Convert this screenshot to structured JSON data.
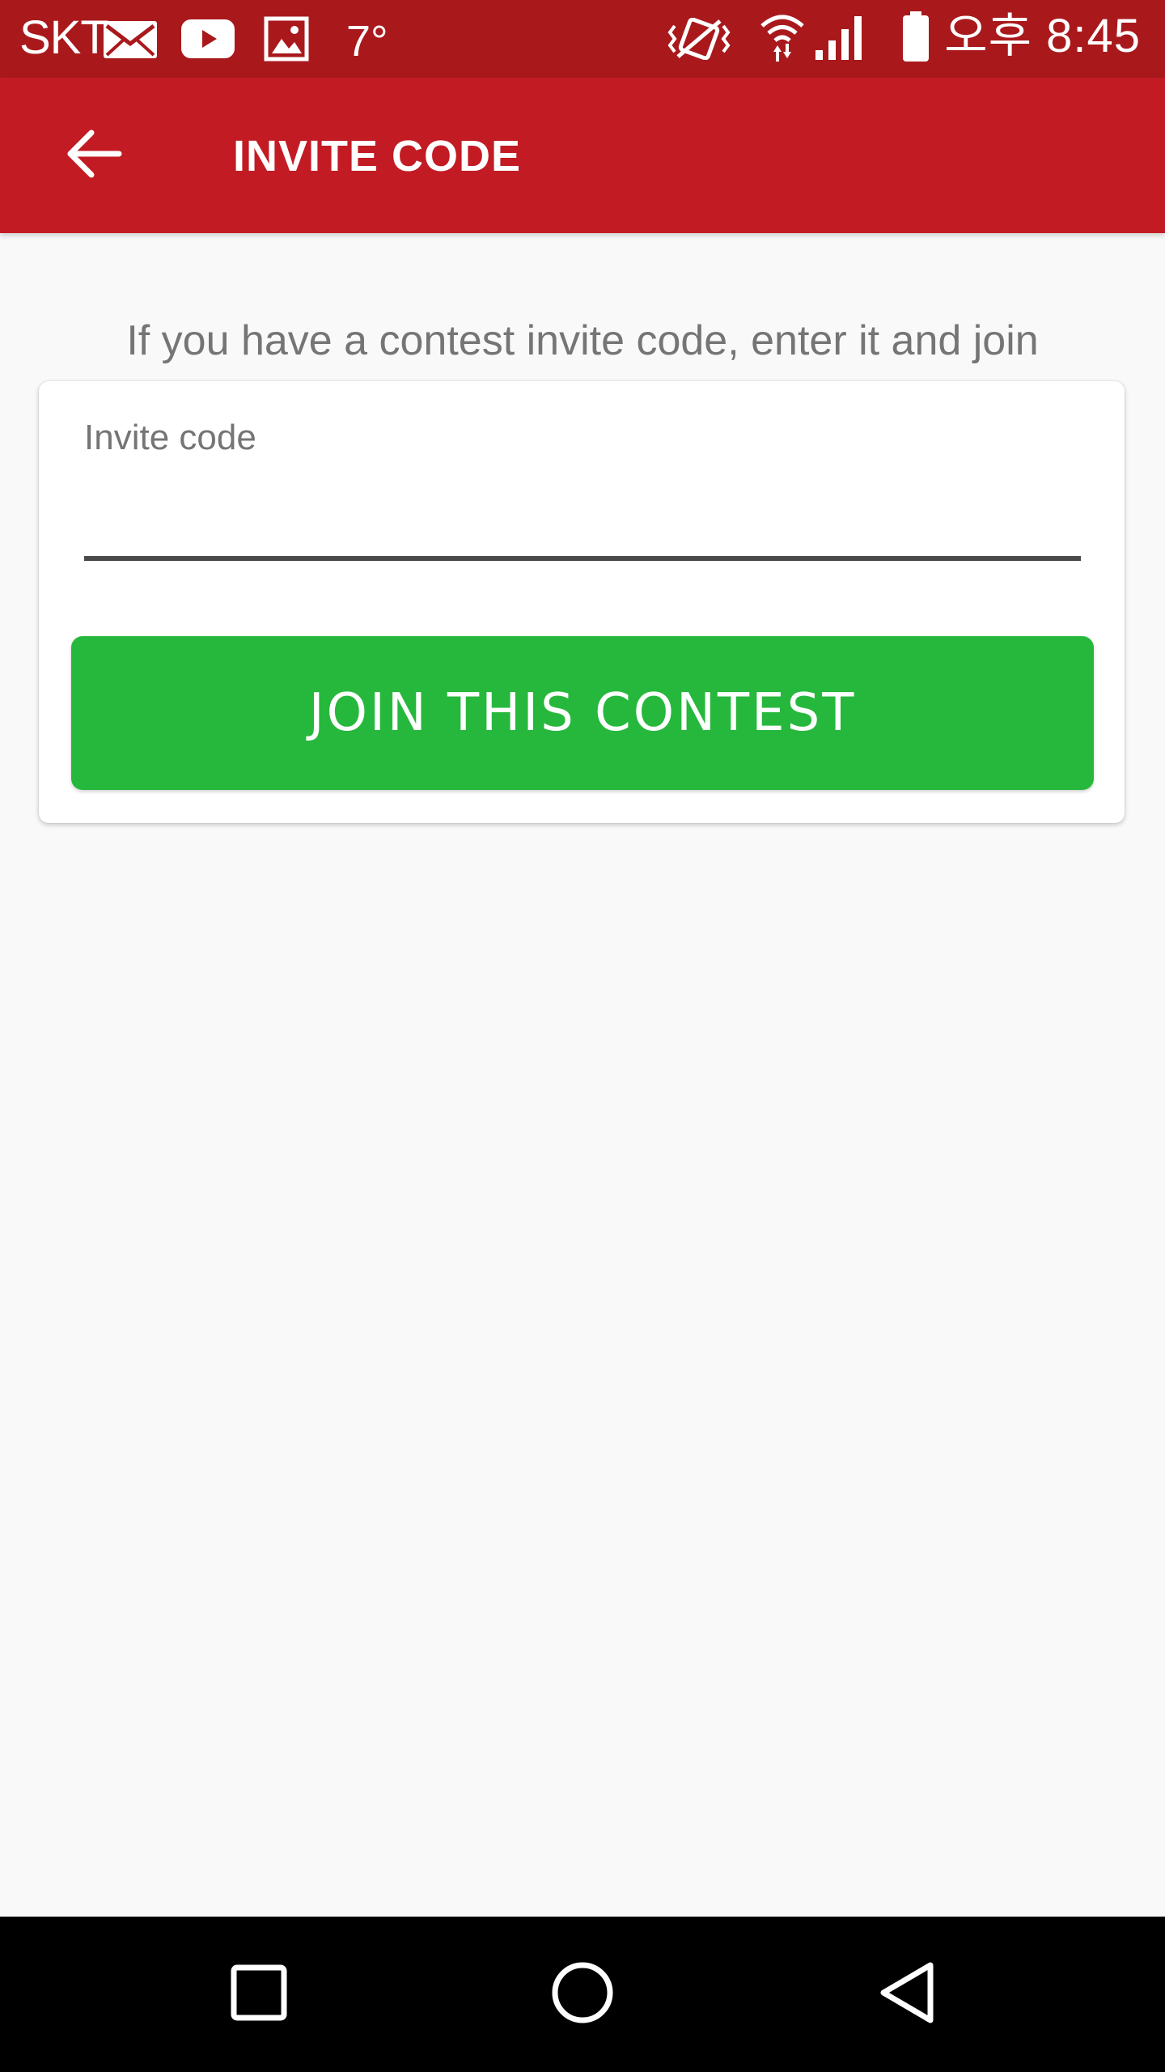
{
  "status_bar": {
    "carrier": "SKT",
    "temperature": "7°",
    "time": "오후 8:45",
    "icons": [
      "mail-icon",
      "youtube-icon",
      "gallery-icon",
      "vibrate-icon",
      "wifi-icon",
      "signal-icon",
      "battery-icon"
    ]
  },
  "app_bar": {
    "title": "INVITE CODE",
    "back_icon": "arrow-back-icon"
  },
  "main": {
    "hint": "If you have a contest invite code, enter it and join",
    "invite_field": {
      "label": "Invite code",
      "value": ""
    },
    "join_button": "JOIN THIS CONTEST"
  },
  "nav_bar": {
    "icons": [
      "recent-apps-icon",
      "home-icon",
      "back-icon"
    ]
  },
  "colors": {
    "status_bar": "#a9191c",
    "app_bar": "#c21b23",
    "join_button": "#26b83c",
    "background": "#f9f9f9"
  }
}
